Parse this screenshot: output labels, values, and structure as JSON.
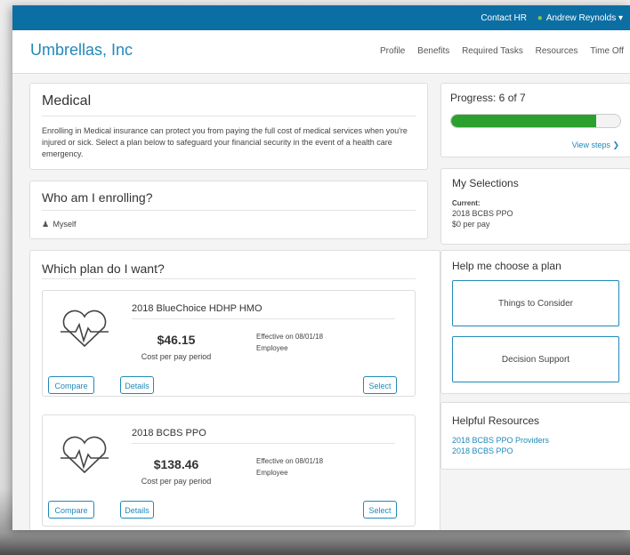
{
  "topbar": {
    "contact_label": "Contact HR",
    "user_name": "Andrew Reynolds ▾"
  },
  "header": {
    "brand": "Umbrellas, Inc"
  },
  "nav": {
    "items": [
      "Profile",
      "Benefits",
      "Required Tasks",
      "Resources",
      "Time Off"
    ]
  },
  "medical": {
    "title": "Medical",
    "description": "Enrolling in Medical insurance can protect you from paying the full cost of medical services when you're injured or sick. Select a plan below to safeguard your financial security in the event of a health care emergency."
  },
  "enrolling": {
    "title": "Who am I enrolling?",
    "person": "Myself"
  },
  "plans": {
    "title": "Which plan do I want?",
    "items": [
      {
        "name": "2018 BlueChoice HDHP HMO",
        "cost": "$46.15",
        "cost_label": "Cost per pay period",
        "effective": "Effective on 08/01/18",
        "coverage": "Employee",
        "compare": "Compare",
        "details": "Details",
        "select": "Select"
      },
      {
        "name": "2018 BCBS PPO",
        "cost": "$138.46",
        "cost_label": "Cost per pay period",
        "effective": "Effective on 08/01/18",
        "coverage": "Employee",
        "compare": "Compare",
        "details": "Details",
        "select": "Select"
      }
    ]
  },
  "progress": {
    "title": "Progress: 6 of 7",
    "fraction": 0.857,
    "view_steps": "View steps ❯",
    "color": "#2ca02c"
  },
  "selections": {
    "title": "My Selections",
    "current_label": "Current:",
    "plan": "2018 BCBS PPO",
    "cost": "$0 per pay"
  },
  "help": {
    "title": "Help me choose a plan",
    "consider": "Things to Consider",
    "decision": "Decision Support"
  },
  "resources": {
    "title": "Helpful Resources",
    "links": [
      "2018 BCBS PPO Providers",
      "2018 BCBS PPO"
    ]
  },
  "colors": {
    "topbar": "#0b6fa4",
    "accent": "#2189b8"
  }
}
